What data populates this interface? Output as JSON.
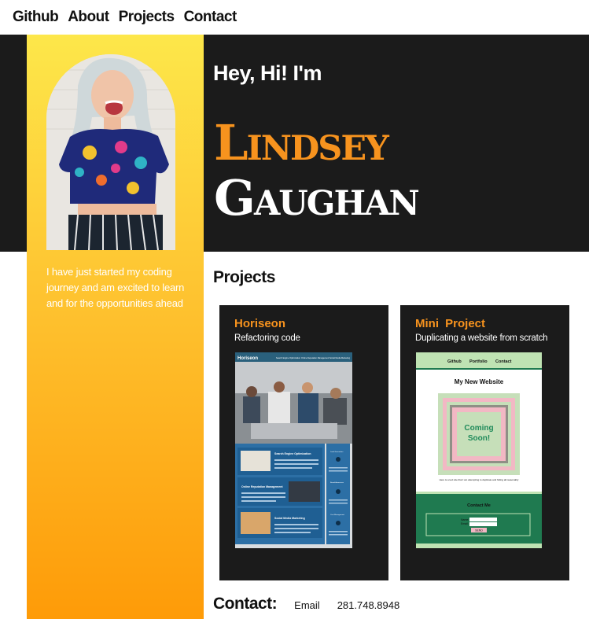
{
  "nav": {
    "items": [
      "Github",
      "About",
      "Projects",
      "Contact"
    ]
  },
  "hero": {
    "greeting": "Hey, Hi! I'm",
    "first_name": "Lindsey",
    "last_name": "Gaughan"
  },
  "sidebar": {
    "bio": "I have just started my coding journey and am excited to learn and for the opportunities ahead"
  },
  "projects": {
    "title": "Projects",
    "cards": [
      {
        "title": "Horiseon",
        "subtitle": "Refactoring code",
        "preview": {
          "brand": "Horiseon",
          "nav": [
            "Search Engine Optimization",
            "Online Reputation Management",
            "Social Media Marketing"
          ],
          "sections": [
            "Search Engine Optimization",
            "Online Reputation Management",
            "Social Media Marketing"
          ],
          "sidebar_labels": [
            "Lead Generation",
            "Brand Awareness",
            "Cost Management"
          ]
        }
      },
      {
        "title": "Mini Project",
        "subtitle": "Duplicating a website from scratch",
        "preview": {
          "nav": [
            "Github",
            "Portfolio",
            "Contact"
          ],
          "heading": "My New Website",
          "badge_line1": "Coming",
          "badge_line2": "Soon!",
          "caption": "Here is a text site that I am attempting to duplicate and hiding all reasonably",
          "contact_title": "Contact Me",
          "form_labels": [
            "Name:",
            "Email:"
          ],
          "send_label": "SEND"
        }
      }
    ]
  },
  "contact": {
    "title": "Contact:",
    "email_label": "Email",
    "phone": "281.748.8948"
  },
  "colors": {
    "accent": "#f7931e",
    "dark": "#1b1b1b",
    "gradient_top": "#fde74a",
    "gradient_bottom": "#fe9b08"
  }
}
